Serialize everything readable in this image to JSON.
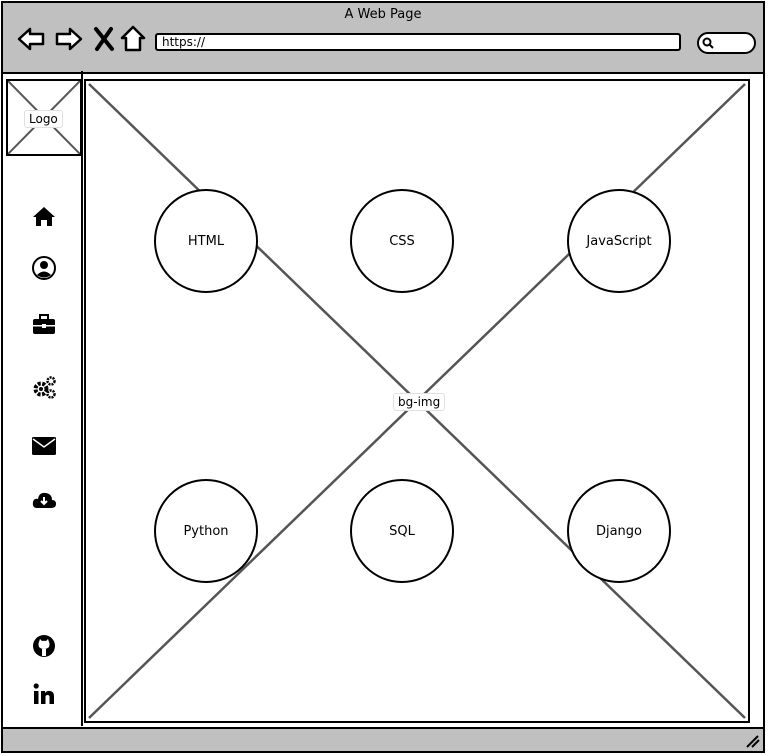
{
  "window": {
    "title": "A Web Page",
    "url": "https://",
    "colors": {
      "chrome": "#c0c0c0",
      "border": "#000000",
      "page": "#ffffff"
    }
  },
  "toolbar": {
    "icons": [
      "back-arrow-icon",
      "forward-arrow-icon",
      "close-x-icon",
      "home-outline-icon",
      "search-icon"
    ]
  },
  "sidebar": {
    "logo_label": "Logo",
    "nav_icons": [
      "home-icon",
      "user-circle-icon",
      "briefcase-icon",
      "gears-icon",
      "envelope-icon",
      "cloud-download-icon"
    ],
    "social_icons": [
      "github-icon",
      "linkedin-icon"
    ]
  },
  "main": {
    "bg_label": "bg-img",
    "skills": [
      "HTML",
      "CSS",
      "JavaScript",
      "Python",
      "SQL",
      "Django"
    ]
  }
}
